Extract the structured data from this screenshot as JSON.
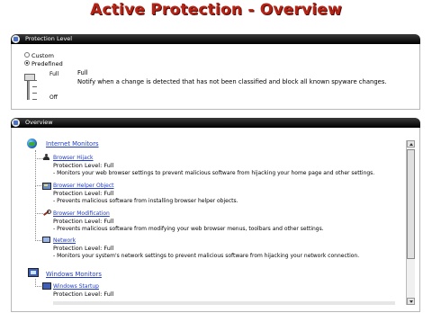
{
  "title": "Active Protection - Overview",
  "protection_level": {
    "header": "Protection Level",
    "options": [
      {
        "label": "Custom",
        "selected": false
      },
      {
        "label": "Predefined",
        "selected": true
      }
    ],
    "slider_labels": {
      "top": "Full",
      "bottom": "Off"
    },
    "current_level": "Full",
    "level_description": "Notify when a change is detected that has not been classified and block all known spyware changes."
  },
  "overview": {
    "header": "Overview",
    "sections": [
      {
        "title": "Internet Monitors",
        "icon": "globe-icon",
        "items": [
          {
            "name": "Browser Hijack",
            "icon": "person-icon",
            "level": "Protection Level: Full",
            "description": "- Monitors your web browser settings to prevent malicious software from hijacking your home page and other settings."
          },
          {
            "name": "Browser Helper Object",
            "icon": "helper-icon",
            "level": "Protection Level: Full",
            "description": "- Prevents malicious software from installing browser helper objects."
          },
          {
            "name": "Browser Modification",
            "icon": "wrench-icon",
            "level": "Protection Level: Full",
            "description": "- Prevents malicious software from modifying your web browser menus, toolbars and other settings."
          },
          {
            "name": "Network",
            "icon": "network-icon",
            "level": "Protection Level: Full",
            "description": "- Monitors your system's network settings to prevent malicious software from hijacking your network connection."
          }
        ]
      },
      {
        "title": "Windows Monitors",
        "icon": "windows-icon",
        "items": [
          {
            "name": "Windows Startup",
            "icon": "windows-startup-icon",
            "level": "Protection Level: Full",
            "description": ""
          }
        ]
      }
    ]
  }
}
